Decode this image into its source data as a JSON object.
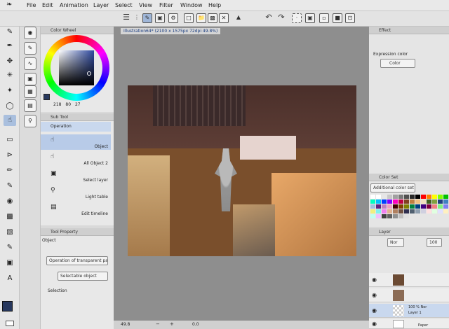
{
  "menu": [
    "File",
    "Edit",
    "Animation",
    "Layer",
    "Select",
    "View",
    "Filter",
    "Window",
    "Help"
  ],
  "canvas_tab": "Illustration64* (2100 x 1575px 72dpi 49.8%)",
  "color_wheel": {
    "title": "Color Wheel",
    "values": [
      "218",
      "80",
      "27"
    ],
    "main_color": "#27385e",
    "sub_color": "#ffffff"
  },
  "subtool": {
    "title": "Sub Tool",
    "group": "Operation",
    "items": [
      "Object",
      "All Object 2",
      "Select layer",
      "Light table",
      "Edit timeline"
    ]
  },
  "tool_property": {
    "title": "Tool Property",
    "section": "Object",
    "dropdown1": "Operation of transparent part",
    "dropdown2": "Selectable object",
    "selection_label": "Selection"
  },
  "status": {
    "zoom": "49.8",
    "angle": "0.0"
  },
  "effect": {
    "title": "Effect",
    "expression_label": "Expression color",
    "expression_value": "Color"
  },
  "color_set": {
    "title": "Color Set",
    "preset": "Additional color set",
    "palette": [
      "#ffffff",
      "#ffffff",
      "#e6e6e6",
      "#c8c8c8",
      "#a0a0a0",
      "#787878",
      "#505050",
      "#282828",
      "#000000",
      "#ff0000",
      "#ff8000",
      "#ffff00",
      "#80ff00",
      "#00c000",
      "#00ffc0",
      "#00c0ff",
      "#0040ff",
      "#8000ff",
      "#ff00c0",
      "#c00040",
      "#804020",
      "#c08040",
      "#f0c080",
      "#f0e0c0",
      "#406020",
      "#80a040",
      "#204080",
      "#4080c0",
      "#a0c0e0",
      "#602080",
      "#c080c0",
      "#f0a0c0",
      "#400000",
      "#804000",
      "#808000",
      "#008040",
      "#004080",
      "#400080",
      "#800040",
      "#f08080",
      "#80f080",
      "#8080f0",
      "#f0f080",
      "#80f0f0",
      "#f080f0",
      "#e0b090",
      "#b08060",
      "#705040",
      "#303050",
      "#506070",
      "#90a0b0",
      "#d0d0e0",
      "#ffe0e0",
      "#e0ffe0",
      "#e0e0ff",
      "#fff0c0",
      "#c0fff0",
      "#f0c0ff",
      "#404040",
      "#606060",
      "#909090",
      "#c0c0c0",
      "#e0e0e0"
    ]
  },
  "layer": {
    "title": "Layer",
    "blend": "Nor",
    "opacity": "100",
    "rows": [
      {
        "name": "",
        "info": "",
        "icon": "checker"
      },
      {
        "name": "",
        "info": "",
        "icon": "3d"
      },
      {
        "name": "Layer 1",
        "info": "100 % Nor",
        "icon": "checker"
      },
      {
        "name": "Paper",
        "info": "",
        "icon": "paper"
      }
    ]
  }
}
